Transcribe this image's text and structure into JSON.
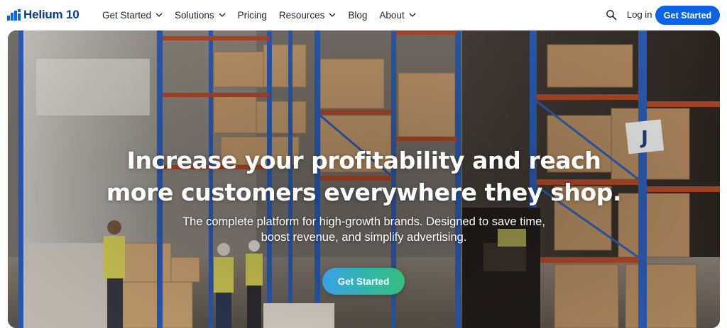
{
  "brand": {
    "name": "Helium 10",
    "color": "#0a3a8a"
  },
  "nav": {
    "items": [
      {
        "label": "Get Started",
        "dropdown": true
      },
      {
        "label": "Solutions",
        "dropdown": true
      },
      {
        "label": "Pricing",
        "dropdown": false
      },
      {
        "label": "Resources",
        "dropdown": true
      },
      {
        "label": "Blog",
        "dropdown": false
      },
      {
        "label": "About",
        "dropdown": true
      }
    ],
    "login_label": "Log in",
    "cta_label": "Get Started",
    "cta_color": "#0b63e5"
  },
  "hero": {
    "title_line1": "Increase your profitability and reach",
    "title_line2_plain": "more customers ",
    "title_line2_bold": "everywhere they shop.",
    "subtitle_line1": "The complete platform for high-growth brands. Designed to save time,",
    "subtitle_line2": "boost revenue, and simplify advertising.",
    "cta_label": "Get Started",
    "cta_gradient": [
      "#3aa0e8",
      "#31b6a8",
      "#33bf7c"
    ],
    "rack_label": "J"
  }
}
